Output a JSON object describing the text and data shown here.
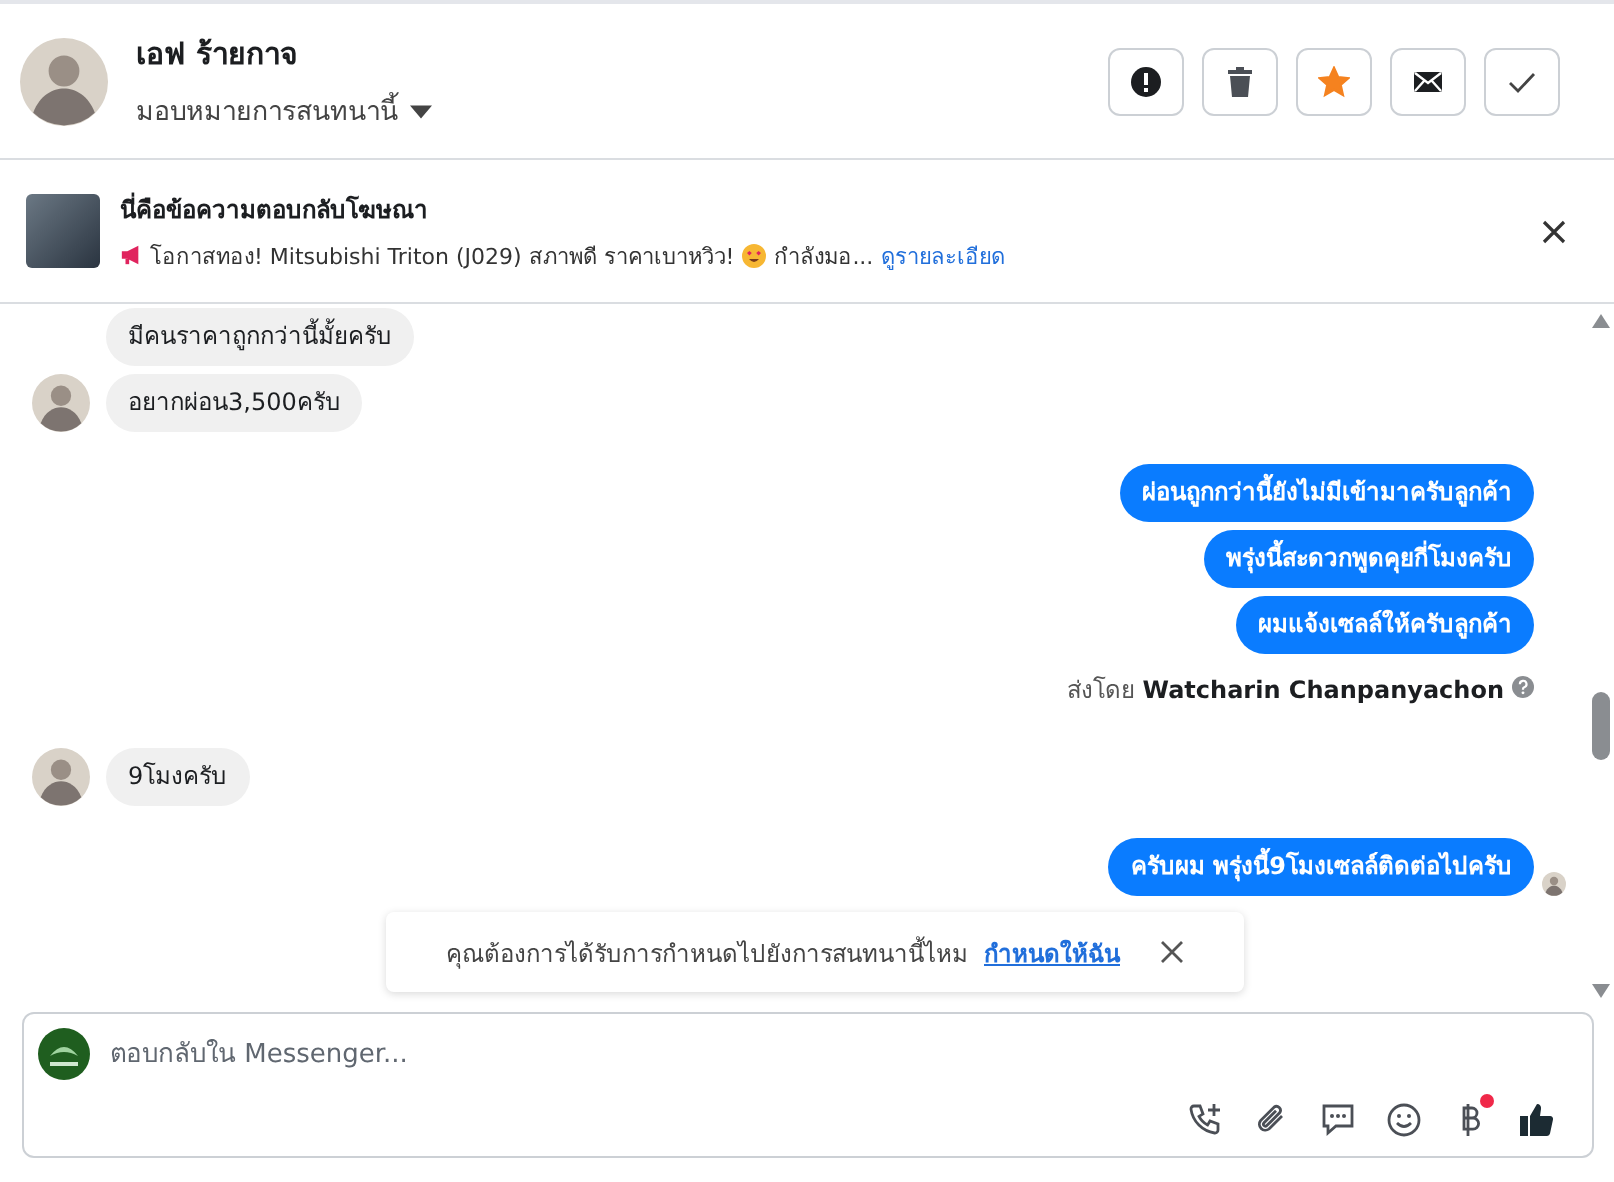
{
  "header": {
    "name": "เอฟ ร้ายกาจ",
    "assign_label": "มอบหมายการสนทนานี้",
    "starred": true
  },
  "ad": {
    "title": "นี่คือข้อความตอบกลับโฆษณา",
    "text_1": "โอกาสทอง! Mitsubishi Triton (J029) สภาพดี ราคาเบาหวิว!",
    "text_2": "กำลังมอ...",
    "link": "ดูรายละเอียด"
  },
  "messages": [
    {
      "kind": "incoming",
      "text": "มีคนราคาถูกกว่านี้มั้ยครับ",
      "avatar": false
    },
    {
      "kind": "incoming",
      "text": "อยากผ่อน3,500ครับ",
      "avatar": true
    },
    {
      "kind": "outgoing",
      "text": "ผ่อนถูกกว่านี้ยังไม่มีเข้ามาครับลูกค้า",
      "seen": false
    },
    {
      "kind": "outgoing",
      "text": "พรุ่งนี้สะดวกพูดคุยกี่โมงครับ",
      "seen": false
    },
    {
      "kind": "outgoing",
      "text": "ผมแจ้งเซลล์ให้ครับลูกค้า",
      "seen": false
    },
    {
      "kind": "sent_by",
      "prefix": "ส่งโดย",
      "name": "Watcharin Chanpanyachon"
    },
    {
      "kind": "incoming",
      "text": "9โมงครับ",
      "avatar": true
    },
    {
      "kind": "outgoing",
      "text": "ครับผม พรุ่งนี้9โมงเซลล์ติดต่อไปครับ",
      "seen": true
    }
  ],
  "banner": {
    "text": "คุณต้องการได้รับการกำหนดไปยังการสนทนานี้ไหม",
    "link": "กำหนดให้ฉัน"
  },
  "composer": {
    "placeholder": "ตอบกลับใน Messenger...",
    "payment_badge": true
  }
}
